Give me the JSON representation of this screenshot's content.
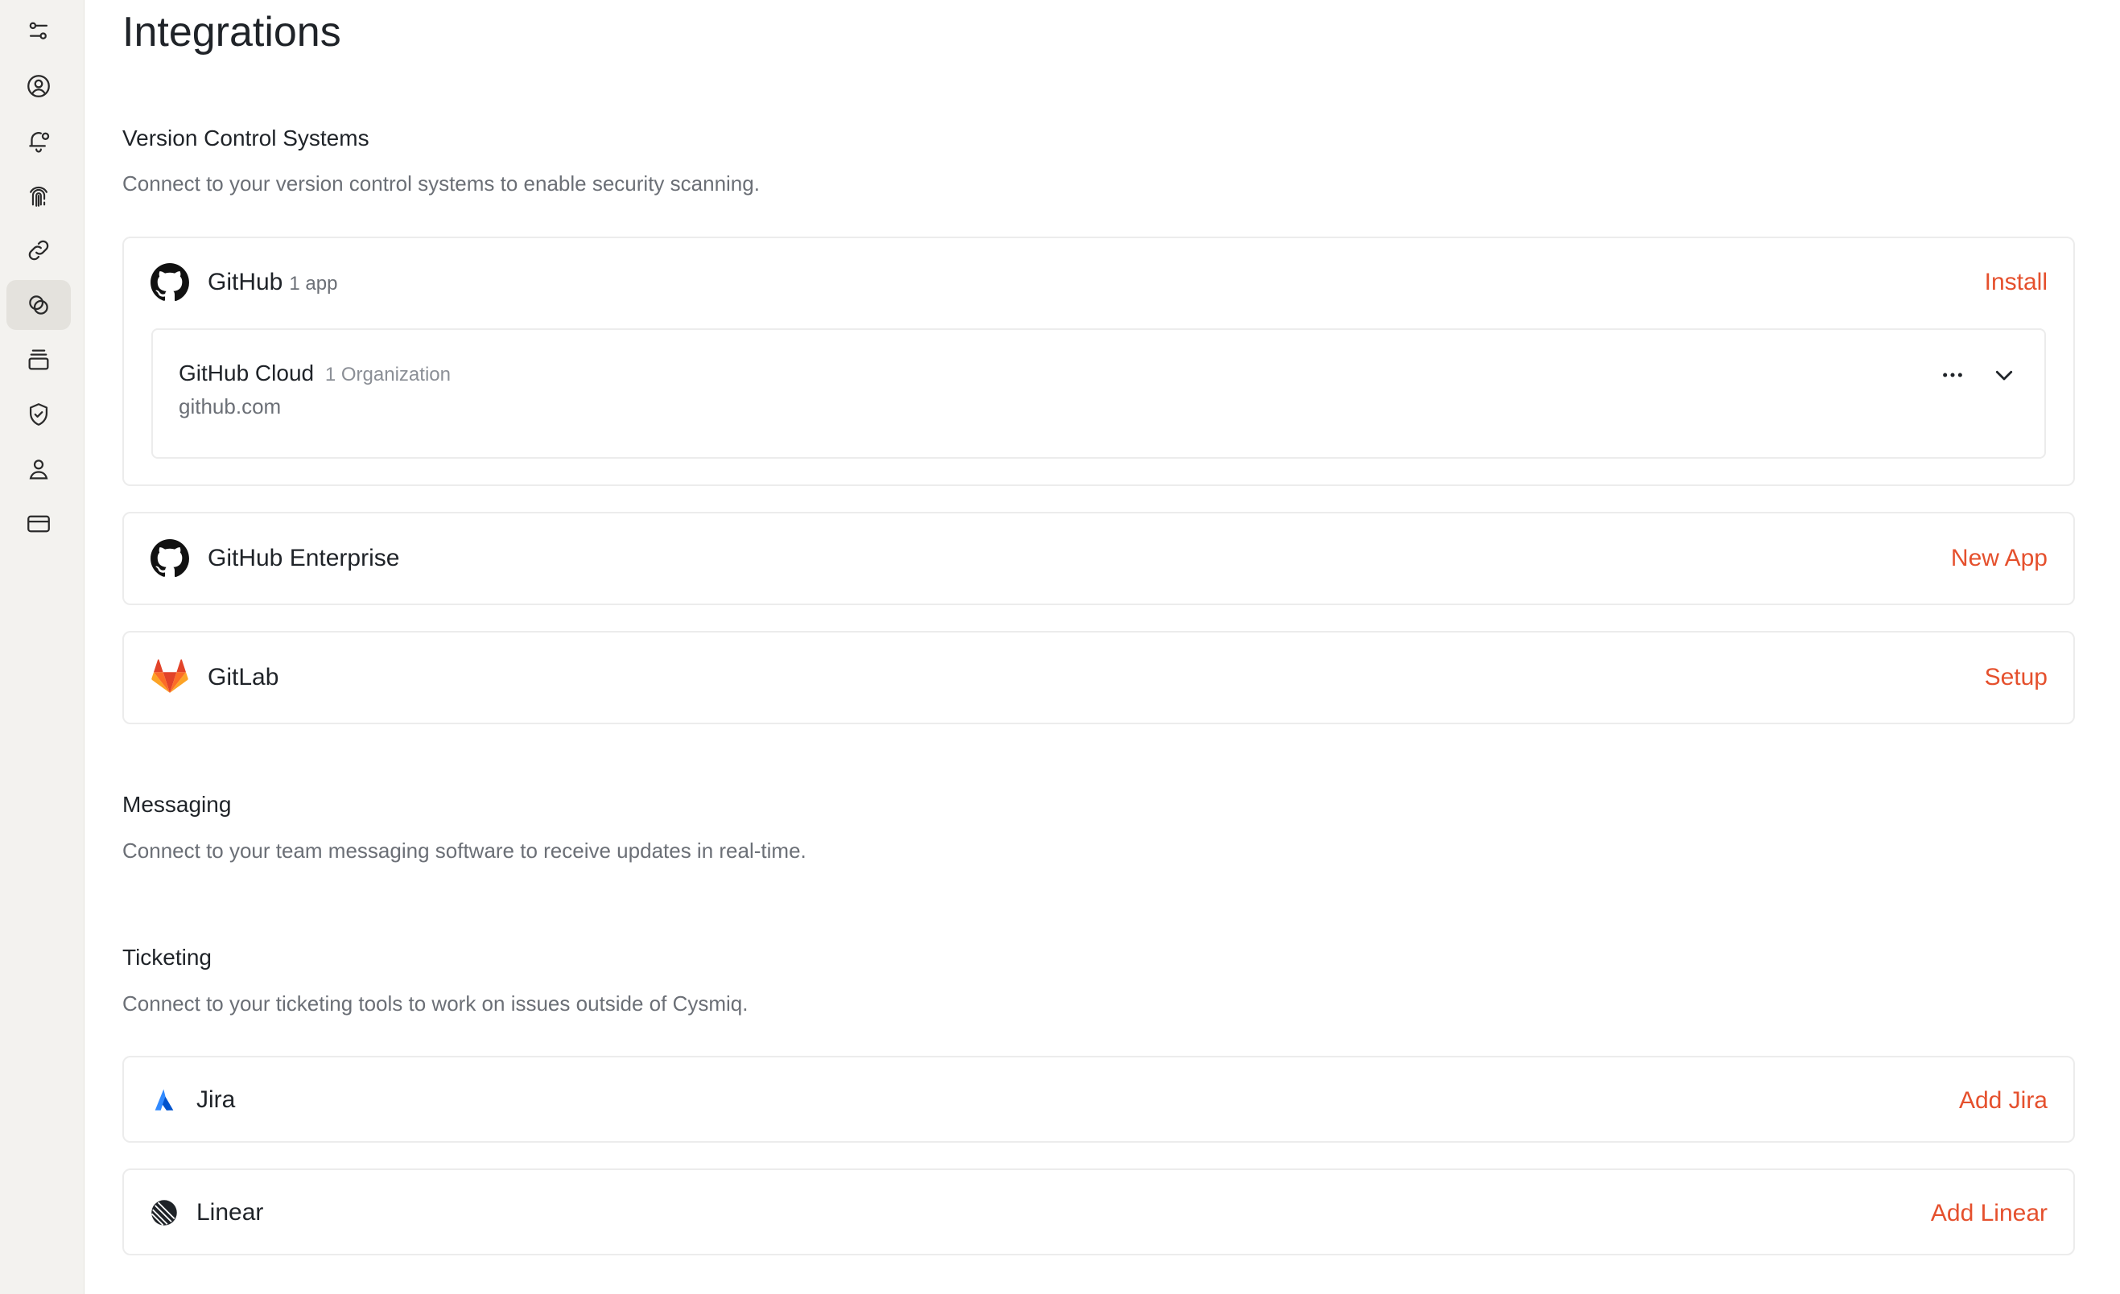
{
  "sidebar": {
    "items": [
      {
        "icon": "settings-sliders-icon",
        "active": false
      },
      {
        "icon": "user-circle-icon",
        "active": false
      },
      {
        "icon": "bell-icon",
        "active": false
      },
      {
        "icon": "fingerprint-icon",
        "active": false
      },
      {
        "icon": "link-icon",
        "active": false
      },
      {
        "icon": "integrations-icon",
        "active": true
      },
      {
        "icon": "stack-icon",
        "active": false
      },
      {
        "icon": "shield-check-icon",
        "active": false
      },
      {
        "icon": "person-icon",
        "active": false
      },
      {
        "icon": "credit-card-icon",
        "active": false
      }
    ]
  },
  "page": {
    "title": "Integrations"
  },
  "vcs": {
    "title": "Version Control Systems",
    "description": "Connect to your version control systems to enable security scanning.",
    "github": {
      "name": "GitHub",
      "meta": "1 app",
      "action": "Install",
      "app": {
        "name": "GitHub Cloud",
        "meta": "1 Organization",
        "host": "github.com"
      }
    },
    "github_enterprise": {
      "name": "GitHub Enterprise",
      "action": "New App"
    },
    "gitlab": {
      "name": "GitLab",
      "action": "Setup"
    }
  },
  "messaging": {
    "title": "Messaging",
    "description": "Connect to your team messaging software to receive updates in real-time."
  },
  "ticketing": {
    "title": "Ticketing",
    "description": "Connect to your ticketing tools to work on issues outside of Cysmiq.",
    "jira": {
      "name": "Jira",
      "action": "Add Jira"
    },
    "linear": {
      "name": "Linear",
      "action": "Add Linear"
    }
  },
  "colors": {
    "accent": "#e5502d",
    "sidebar_bg": "#f3f2ef",
    "jira_blue": "#2684ff",
    "gitlab_orange": "#e24329"
  }
}
